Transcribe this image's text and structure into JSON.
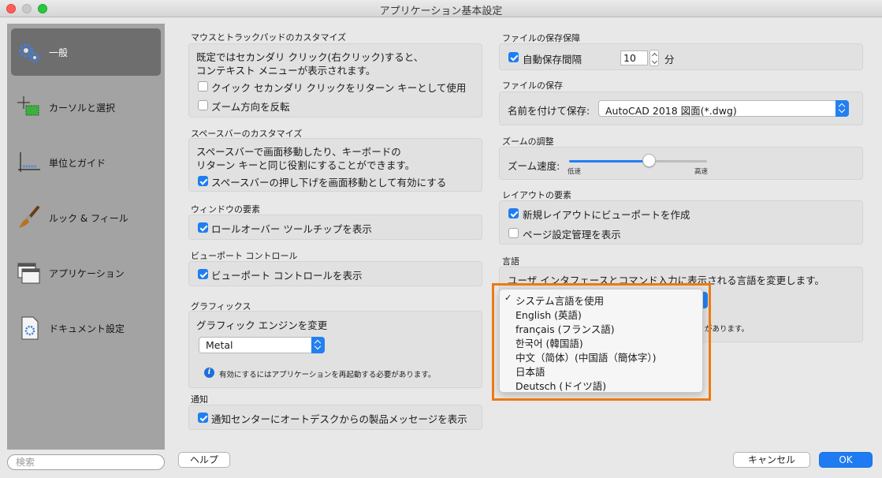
{
  "window": {
    "title": "アプリケーション基本設定"
  },
  "sidebar": {
    "items": [
      {
        "label": "一般",
        "icon": "gear-icon",
        "selected": true
      },
      {
        "label": "カーソルと選択",
        "icon": "cursor-selection-icon",
        "selected": false
      },
      {
        "label": "単位とガイド",
        "icon": "units-guides-icon",
        "selected": false
      },
      {
        "label": "ルック & フィール",
        "icon": "brush-icon",
        "selected": false
      },
      {
        "label": "アプリケーション",
        "icon": "application-windows-icon",
        "selected": false
      },
      {
        "label": "ドキュメント設定",
        "icon": "document-settings-icon",
        "selected": false
      }
    ],
    "search_placeholder": "検索"
  },
  "left": {
    "mouse": {
      "title": "マウスとトラックパッドのカスタマイズ",
      "desc_line1": "既定ではセカンダリ クリック(右クリック)すると、",
      "desc_line2": "コンテキスト メニューが表示されます。",
      "option1": {
        "label": "クイック セカンダリ クリックをリターン キーとして使用",
        "checked": false
      },
      "option2": {
        "label": "ズーム方向を反転",
        "checked": false
      }
    },
    "spacebar": {
      "title": "スペースバーのカスタマイズ",
      "desc_line1": "スペースバーで画面移動したり、キーボードの",
      "desc_line2": "リターン キーと同じ役割にすることができます。",
      "option1": {
        "label": "スペースバーの押し下げを画面移動として有効にする",
        "checked": true
      }
    },
    "window_elements": {
      "title": "ウィンドウの要素",
      "option1": {
        "label": "ロールオーバー ツールチップを表示",
        "checked": true
      }
    },
    "viewport": {
      "title": "ビューポート コントロール",
      "option1": {
        "label": "ビューポート コントロールを表示",
        "checked": true
      }
    },
    "graphics": {
      "title": "グラフィックス",
      "engine_label": "グラフィック エンジンを変更",
      "engine_value": "Metal",
      "note": "有効にするにはアプリケーションを再起動する必要があります。"
    },
    "notification": {
      "title": "通知",
      "option1": {
        "label": "通知センターにオートデスクからの製品メッセージを表示",
        "checked": true
      }
    }
  },
  "right": {
    "autosave": {
      "title": "ファイルの保存保障",
      "option_label": "自動保存間隔",
      "checked": true,
      "interval": "10",
      "unit": "分"
    },
    "save": {
      "title": "ファイルの保存",
      "label": "名前を付けて保存:",
      "value": "AutoCAD 2018 図面(*.dwg)"
    },
    "zoom": {
      "title": "ズームの調整",
      "label": "ズーム速度:",
      "low": "低速",
      "high": "高速",
      "level": 0.58
    },
    "layout": {
      "title": "レイアウトの要素",
      "option1": {
        "label": "新規レイアウトにビューポートを作成",
        "checked": true
      },
      "option2": {
        "label": "ページ設定管理を表示",
        "checked": false
      }
    },
    "language": {
      "title": "言語",
      "desc": "ユーザ インタフェースとコマンド入力に表示される言語を変更します。",
      "note_tail": "があります。",
      "options": [
        {
          "label": "システム言語を使用",
          "checked": true
        },
        {
          "label": "English (英語)",
          "checked": false
        },
        {
          "label": "français (フランス語)",
          "checked": false
        },
        {
          "label": "한국어 (韓国語)",
          "checked": false
        },
        {
          "label": "中文（简体）(中国語（簡体字）)",
          "checked": false
        },
        {
          "label": "日本語",
          "checked": false
        },
        {
          "label": "Deutsch (ドイツ語)",
          "checked": false
        }
      ],
      "check_mark": "✓"
    }
  },
  "footer": {
    "help_label": "ヘルプ",
    "cancel_label": "キャンセル",
    "ok_label": "OK"
  },
  "colors": {
    "accent": "#1f7bf2",
    "highlight": "#ec7a12",
    "sidebar": "#a3a3a3",
    "sidebar_selected": "#6e6e6e"
  }
}
